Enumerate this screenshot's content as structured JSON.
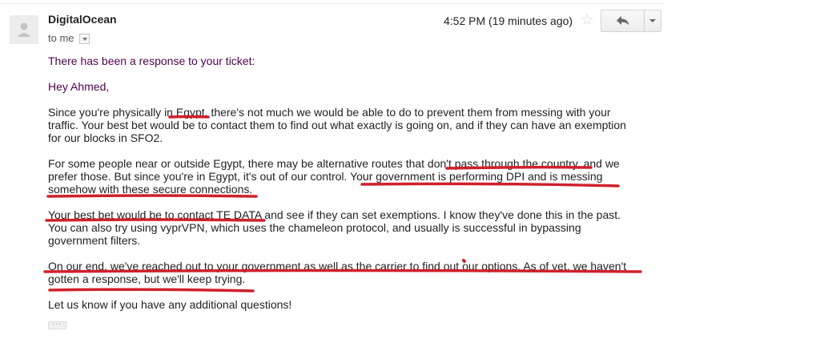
{
  "header": {
    "sender": "DigitalOcean",
    "recipient": "to me",
    "timestamp": "4:52 PM (19 minutes ago)"
  },
  "icons": {
    "avatar": "person-icon",
    "star": "star-outline-icon",
    "reply": "reply-arrow-icon",
    "more": "chevron-down-icon",
    "recipient_details": "caret-down-icon",
    "trimmed_content": "ellipsis-icon"
  },
  "colors": {
    "annotation": "#d0202c",
    "quoted_text": "#500050"
  },
  "message": {
    "intro": "There has been a response to your ticket:",
    "greeting": "Hey Ahmed,",
    "p1": {
      "a": "Since you're physically in Egypt, there's not much we would be able to do to prevent them from messing with your",
      "b": "traffic. Your best bet would be to contact them to find out what exactly is going on, and if they can have an exemption",
      "c": "for our blocks in SFO2."
    },
    "p2": {
      "a": "For some people near or outside Egypt, there may be alternative routes that don't pass through the country, and we",
      "b": "prefer those. But since you're in Egypt, it's out of our control. Your government is performing DPI and is messing",
      "c": "somehow with these secure connections."
    },
    "p3": {
      "a": "Your best bet would be to contact TE DATA and see if they can set exemptions. I know they've done this in the past.",
      "b": "You can also try using vyprVPN, which uses the chameleon protocol, and usually is successful in bypassing",
      "c": "government filters."
    },
    "p4": {
      "a": "On our end, we've reached out to your government as well as the carrier to find out our options. As of yet, we haven't",
      "b": "gotten a response, but we'll keep trying."
    },
    "closing": "Let us know if you have any additional questions!"
  }
}
